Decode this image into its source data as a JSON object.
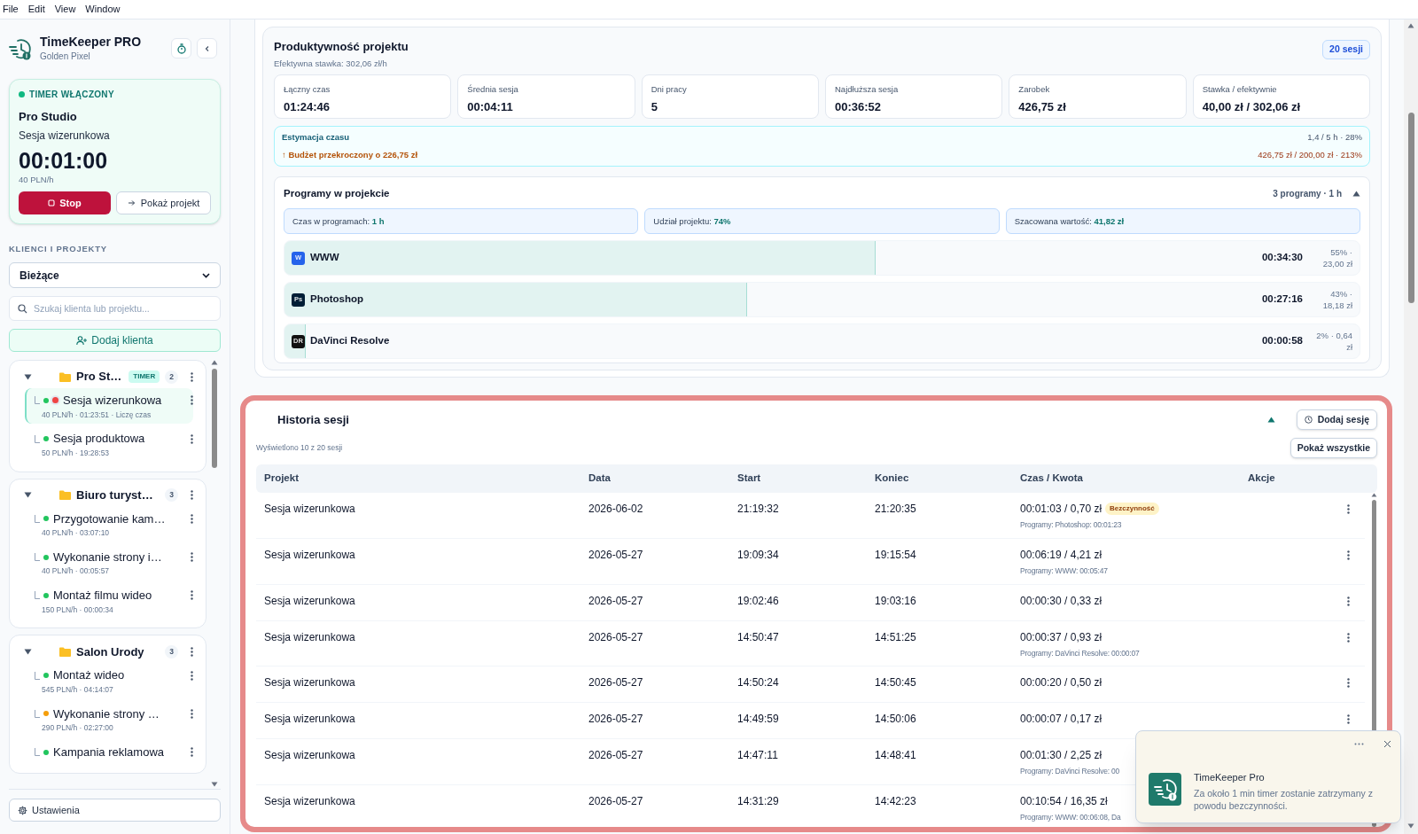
{
  "menu": [
    {
      "label": "File"
    },
    {
      "label": "Edit"
    },
    {
      "label": "View"
    },
    {
      "label": "Window"
    }
  ],
  "sidebar": {
    "app_title": "TimeKeeper PRO",
    "app_subtitle": "Golden Pixel",
    "timer": {
      "status": "TIMER WŁĄCZONY",
      "running": true,
      "client": "Pro Studio",
      "project": "Sesja wizerunkowa",
      "elapsed": "00:01:00",
      "rate": "40 PLN/h",
      "stop_label": "Stop",
      "show_label": "Pokaż projekt"
    },
    "section_title": "KLIENCI I PROJEKTY",
    "filter": {
      "value": "Bieżące"
    },
    "search": {
      "placeholder": "Szukaj klienta lub projektu..."
    },
    "add_client": "Dodaj klienta",
    "clients": [
      {
        "name": "Pro St…",
        "badge": "TIMER",
        "count": "2",
        "expanded": true,
        "projects": [
          {
            "name": "Sesja wizerunkowa",
            "meta": "40 PLN/h · 01:23:51 · Liczę czas",
            "color": "#22c55e",
            "recording": true,
            "selected": true
          },
          {
            "name": "Sesja produktowa",
            "meta": "50 PLN/h · 19:28:53",
            "color": "#22c55e",
            "recording": false,
            "selected": false
          }
        ]
      },
      {
        "name": "Biuro turyst…",
        "count": "3",
        "expanded": true,
        "projects": [
          {
            "name": "Przygotowanie kam…",
            "meta": "40 PLN/h · 03:07:10",
            "color": "#22c55e",
            "recording": false,
            "selected": false
          },
          {
            "name": "Wykonanie strony i…",
            "meta": "40 PLN/h · 00:05:57",
            "color": "#22c55e",
            "recording": false,
            "selected": false
          },
          {
            "name": "Montaż filmu wideo",
            "meta": "150 PLN/h · 00:00:34",
            "color": "#22c55e",
            "recording": false,
            "selected": false
          }
        ]
      },
      {
        "name": "Salon Urody",
        "count": "3",
        "expanded": true,
        "projects": [
          {
            "name": "Montaż wideo",
            "meta": "545 PLN/h · 04:14:07",
            "color": "#22c55e",
            "recording": false,
            "selected": false
          },
          {
            "name": "Wykonanie strony …",
            "meta": "290 PLN/h · 02:27:00",
            "color": "#f59e0b",
            "recording": false,
            "selected": false
          },
          {
            "name": "Kampania reklamowa",
            "color": "#22c55e",
            "recording": false,
            "selected": false
          }
        ]
      }
    ],
    "settings": "Ustawienia"
  },
  "productivity": {
    "title": "Produktywność projektu",
    "subtitle": "Efektywna stawka: 302,06 zł/h",
    "badge": "20 sesji",
    "stats": [
      {
        "label": "Łączny czas",
        "value": "01:24:46"
      },
      {
        "label": "Średnia sesja",
        "value": "00:04:11"
      },
      {
        "label": "Dni pracy",
        "value": "5"
      },
      {
        "label": "Najdłuższa sesja",
        "value": "00:36:52"
      },
      {
        "label": "Zarobek",
        "value": "426,75 zł"
      },
      {
        "label": "Stawka / efektywnie",
        "value": "40,00 zł / 302,06 zł"
      }
    ],
    "estimate": {
      "title": "Estymacja czasu",
      "warning": "↑ Budżet przekroczony o 226,75 zł",
      "hours": "1,4 / 5 h · 28%",
      "budget": "426,75 zł / 200,00 zł · 213%"
    },
    "programs": {
      "title": "Programy w projekcie",
      "summary": "3 programy · 1 h",
      "expanded": true,
      "chips": [
        "Czas w programach: **1 h**",
        "Udział projektu: **74%**",
        "Szacowana wartość: **41,82 zł**"
      ],
      "items": [
        {
          "icon_text": "W",
          "color": "#2563eb",
          "name": "WWW",
          "level": 0.55,
          "time": "00:34:30",
          "share": "55% · 23,00 zł"
        },
        {
          "icon_text": "Ps",
          "color": "#001e36",
          "name": "Photoshop",
          "level": 0.43,
          "time": "00:27:16",
          "share": "43% · 18,18 zł"
        },
        {
          "icon_text": "DR",
          "color": "#111111",
          "name": "DaVinci Resolve",
          "level": 0.02,
          "time": "00:00:58",
          "share": "2% · 0,64 zł"
        }
      ]
    }
  },
  "history": {
    "title": "Historia sesji",
    "expanded": true,
    "add_label": "Dodaj sesję",
    "count": "Wyświetlono 10 z 20 sesji",
    "show_all": "Pokaż wszystkie",
    "columns": [
      "Projekt",
      "Data",
      "Start",
      "Koniec",
      "Czas / Kwota",
      "Akcje"
    ],
    "rows": [
      {
        "project": "Sesja wizerunkowa",
        "date": "2026-06-02",
        "start": "21:19:32",
        "end": "21:20:35",
        "amount": "00:01:03 / 0,70 zł",
        "badge": "Bezczynność",
        "programs": "Programy: Photoshop: 00:01:23"
      },
      {
        "project": "Sesja wizerunkowa",
        "date": "2026-05-27",
        "start": "19:09:34",
        "end": "19:15:54",
        "amount": "00:06:19 / 4,21 zł",
        "programs": "Programy: WWW: 00:05:47"
      },
      {
        "project": "Sesja wizerunkowa",
        "date": "2026-05-27",
        "start": "19:02:46",
        "end": "19:03:16",
        "amount": "00:00:30 / 0,33 zł"
      },
      {
        "project": "Sesja wizerunkowa",
        "date": "2026-05-27",
        "start": "14:50:47",
        "end": "14:51:25",
        "amount": "00:00:37 / 0,93 zł",
        "programs": "Programy: DaVinci Resolve: 00:00:07"
      },
      {
        "project": "Sesja wizerunkowa",
        "date": "2026-05-27",
        "start": "14:50:24",
        "end": "14:50:45",
        "amount": "00:00:20 / 0,50 zł"
      },
      {
        "project": "Sesja wizerunkowa",
        "date": "2026-05-27",
        "start": "14:49:59",
        "end": "14:50:06",
        "amount": "00:00:07 / 0,17 zł"
      },
      {
        "project": "Sesja wizerunkowa",
        "date": "2026-05-27",
        "start": "14:47:11",
        "end": "14:48:41",
        "amount": "00:01:30 / 2,25 zł",
        "programs": "Programy: DaVinci Resolve: 00"
      },
      {
        "project": "Sesja wizerunkowa",
        "date": "2026-05-27",
        "start": "14:31:29",
        "end": "14:42:23",
        "amount": "00:10:54 / 16,35 zł",
        "programs": "Programy: WWW: 00:06:08, Da"
      }
    ]
  },
  "toast": {
    "app": "TimeKeeper Pro",
    "message": "Za około 1 min timer zostanie zatrzymany z powodu bezczynności."
  }
}
